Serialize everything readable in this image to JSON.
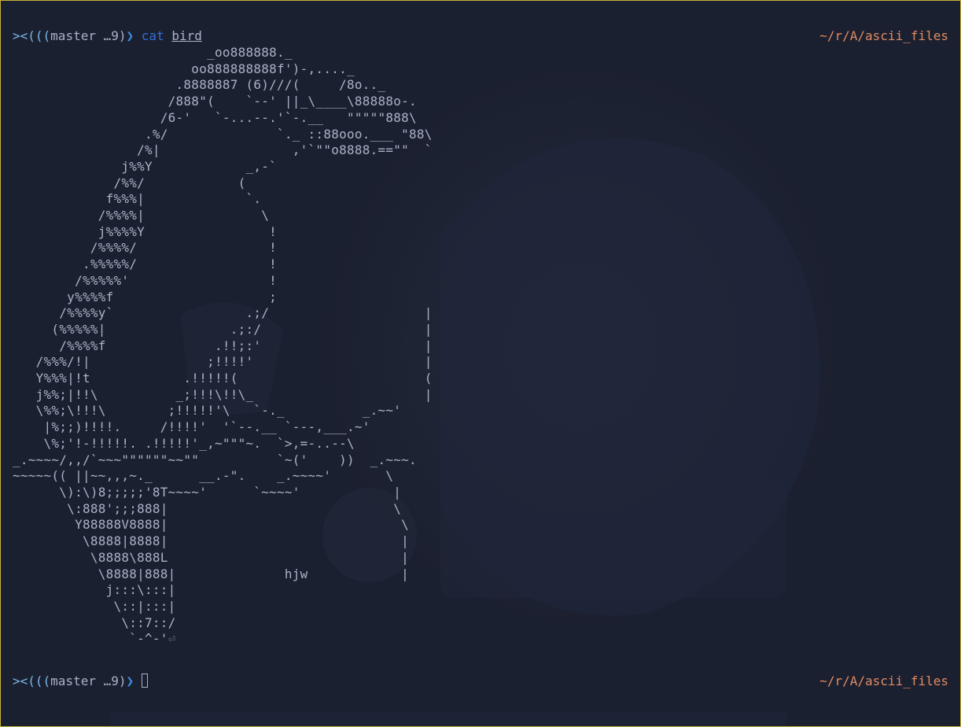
{
  "prompt": {
    "symbol": "><(((",
    "branch": "master …9)",
    "arrow": "❯",
    "command": "cat",
    "argument": "bird",
    "path": "~/r/A/ascii_files"
  },
  "ascii_art_lines": [
    "                         _oo888888._",
    "                       oo888888888f')-,...._",
    "                     .8888887 (6)///(     /8o.._",
    "                    /888\"(    `--' ||_\\____\\88888o-.",
    "                   /6-'   `-...--.'`-.__   \"\"\"\"\"888\\",
    "                 .%/              `._ ::88ooo.___ \"88\\",
    "                /%|                 ,'`\"\"o8888.==\"\"  `",
    "              j%%Y            _,-`",
    "             /%%/            (",
    "            f%%%|             `.",
    "           /%%%%|               \\",
    "           j%%%%Y                !",
    "          /%%%%/                 !",
    "         .%%%%%/                 !",
    "        /%%%%%'                  !",
    "       y%%%%f                    ;",
    "      /%%%%y`                 .;/                    |",
    "     (%%%%%|                .;:/                     |",
    "      /%%%%f              .!!;:'                     |",
    "   /%%%/!|               ;!!!!'                      |",
    "   Y%%%|!t            .!!!!!(                        (",
    "   j%%;|!!\\          _;!!!\\!!\\_                      |",
    "   \\%%;\\!!!\\        ;!!!!!'\\   `-._          _.~~'",
    "    |%;;)!!!!.     /!!!!'  '`--.__ `---,___.~'",
    "    \\%;'!-!!!!!. .!!!!!'_,~\"\"\"~.  `>,=-..--\\",
    "_.~~~~/,,/`~~~\"\"\"\"\"\"~~\"\"          `~('    ))  _.~~~.",
    "~~~~~(( ||~~,,,~._      __.-\".    _.~~~~'       \\",
    "      \\):\\)8;;;;;'8T~~~~'      `~~~~'            |",
    "       \\:888';;;888|                             \\",
    "        Y88888V8888|                              \\",
    "         \\8888|8888|                              |",
    "          \\8888\\888L                              |",
    "           \\8888|888|              hjw            |",
    "            j:::\\:::|",
    "             \\::|:::|",
    "              \\::7::/",
    "               `-^-'"
  ],
  "return_symbol": "⏎",
  "prompt2": {
    "symbol": "><(((",
    "branch": "master …9)",
    "arrow": "❯",
    "path": "~/r/A/ascii_files"
  }
}
